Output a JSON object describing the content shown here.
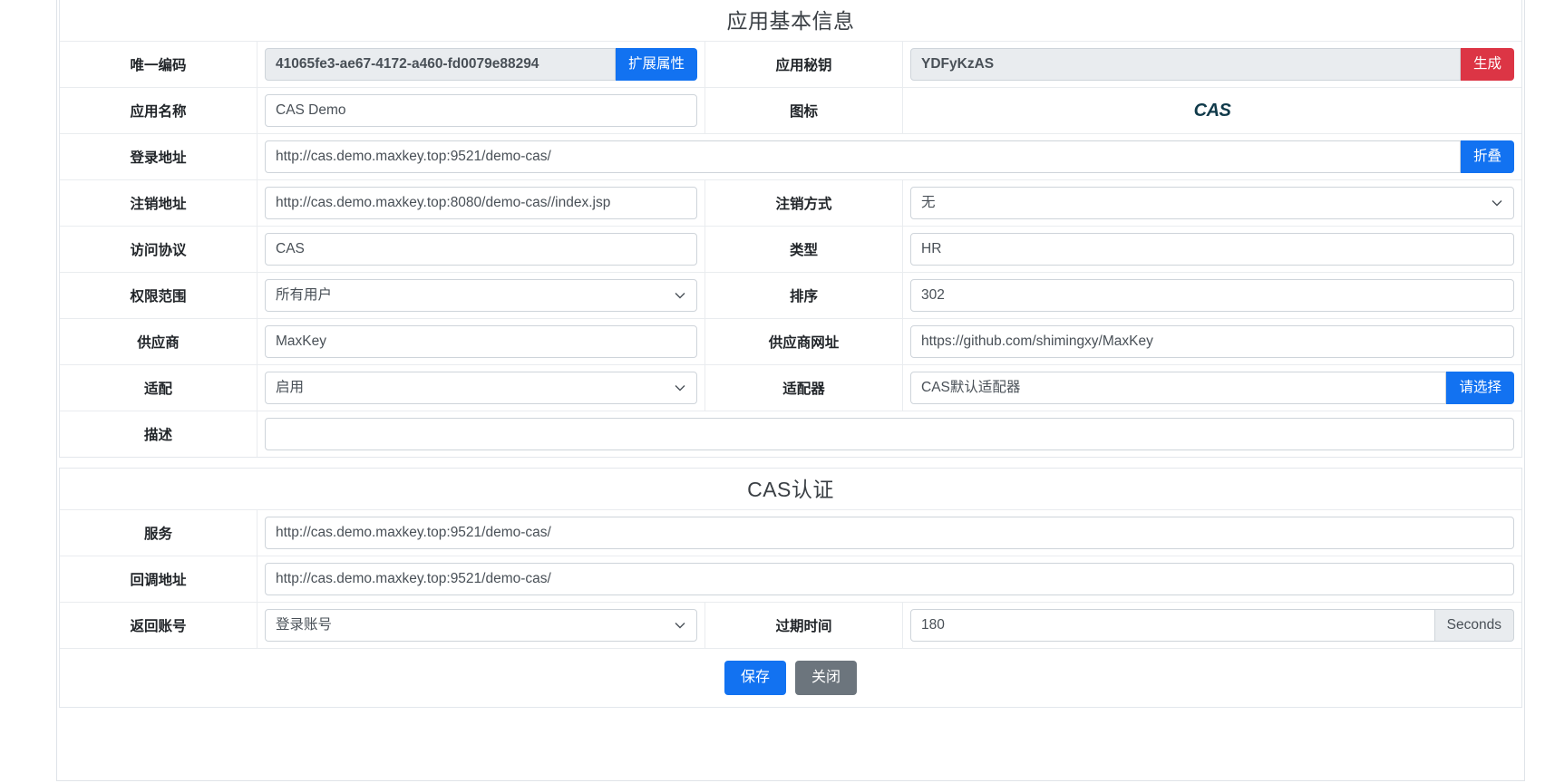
{
  "sections": [
    {
      "title": "应用基本信息",
      "rows": [
        {
          "left_label": "唯一编码",
          "left_value": "41065fe3-ae67-4172-a460-fd0079e88294",
          "left_button": "扩展属性",
          "right_label": "应用秘钥",
          "right_value": "YDFyKzAS",
          "right_button": "生成"
        },
        {
          "left_label": "应用名称",
          "left_value": "CAS Demo",
          "right_label": "图标",
          "right_icon": "cas-logo-icon",
          "right_icon_text": "CAS"
        },
        {
          "left_label": "登录地址",
          "left_value": "http://cas.demo.maxkey.top:9521/demo-cas/",
          "right_button": "折叠"
        },
        {
          "left_label": "注销地址",
          "left_value": "http://cas.demo.maxkey.top:8080/demo-cas//index.jsp",
          "right_label": "注销方式",
          "right_value": "无"
        },
        {
          "left_label": "访问协议",
          "left_value": "CAS",
          "right_label": "类型",
          "right_value": "HR"
        },
        {
          "left_label": "权限范围",
          "left_value": "所有用户",
          "right_label": "排序",
          "right_value": "302"
        },
        {
          "left_label": "供应商",
          "left_value": "MaxKey",
          "right_label": "供应商网址",
          "right_value": "https://github.com/shimingxy/MaxKey"
        },
        {
          "left_label": "适配",
          "left_value": "启用",
          "right_label": "适配器",
          "right_value": "CAS默认适配器",
          "right_button": "请选择"
        },
        {
          "left_label": "描述",
          "left_value": ""
        }
      ]
    },
    {
      "title": "CAS认证",
      "rows": [
        {
          "left_label": "服务",
          "left_value": "http://cas.demo.maxkey.top:9521/demo-cas/"
        },
        {
          "left_label": "回调地址",
          "left_value": "http://cas.demo.maxkey.top:9521/demo-cas/"
        },
        {
          "left_label": "返回账号",
          "left_value": "登录账号",
          "right_label": "过期时间",
          "right_value": "180",
          "right_addon": "Seconds"
        }
      ]
    }
  ],
  "actions": {
    "save_label": "保存",
    "close_label": "关闭"
  },
  "colors": {
    "primary": "#1272f1",
    "danger": "#dc3545",
    "secondary": "#6c757d",
    "readonly_bg": "#e9ecef"
  }
}
